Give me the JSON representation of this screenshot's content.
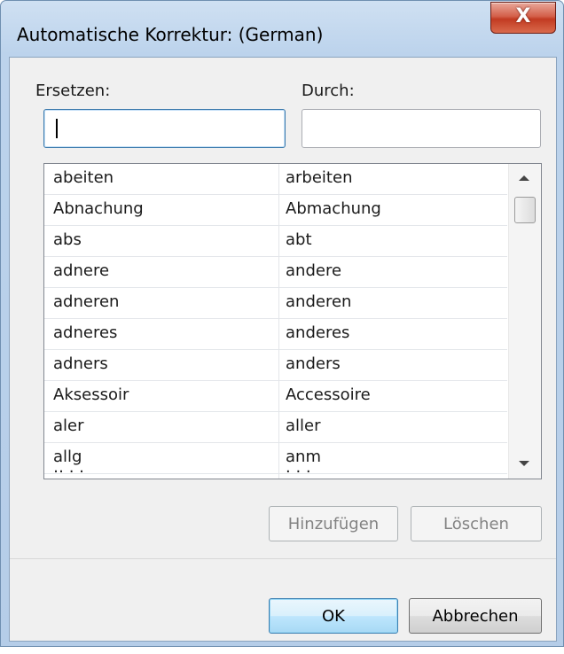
{
  "dialog": {
    "title": "Automatische Korrektur: (German)",
    "close_glyph": "X",
    "replace_label": "Ersetzen:",
    "with_label": "Durch:",
    "replace_value": "",
    "with_value": "",
    "entries": [
      {
        "from": "abeiten",
        "to": "arbeiten"
      },
      {
        "from": "Abnachung",
        "to": "Abmachung"
      },
      {
        "from": "abs",
        "to": "abt"
      },
      {
        "from": "adnere",
        "to": "andere"
      },
      {
        "from": "adneren",
        "to": "anderen"
      },
      {
        "from": "adneres",
        "to": "anderes"
      },
      {
        "from": "adners",
        "to": "anders"
      },
      {
        "from": "Aksessoir",
        "to": "Accessoire"
      },
      {
        "from": "aler",
        "to": "aller"
      },
      {
        "from": "allg",
        "to": "anm"
      }
    ],
    "add_label": "Hinzufügen",
    "delete_label": "Löschen",
    "ok_label": "OK",
    "cancel_label": "Abbrechen",
    "icons": {
      "scroll_up": "arrow-up-icon",
      "scroll_down": "arrow-down-icon"
    }
  }
}
